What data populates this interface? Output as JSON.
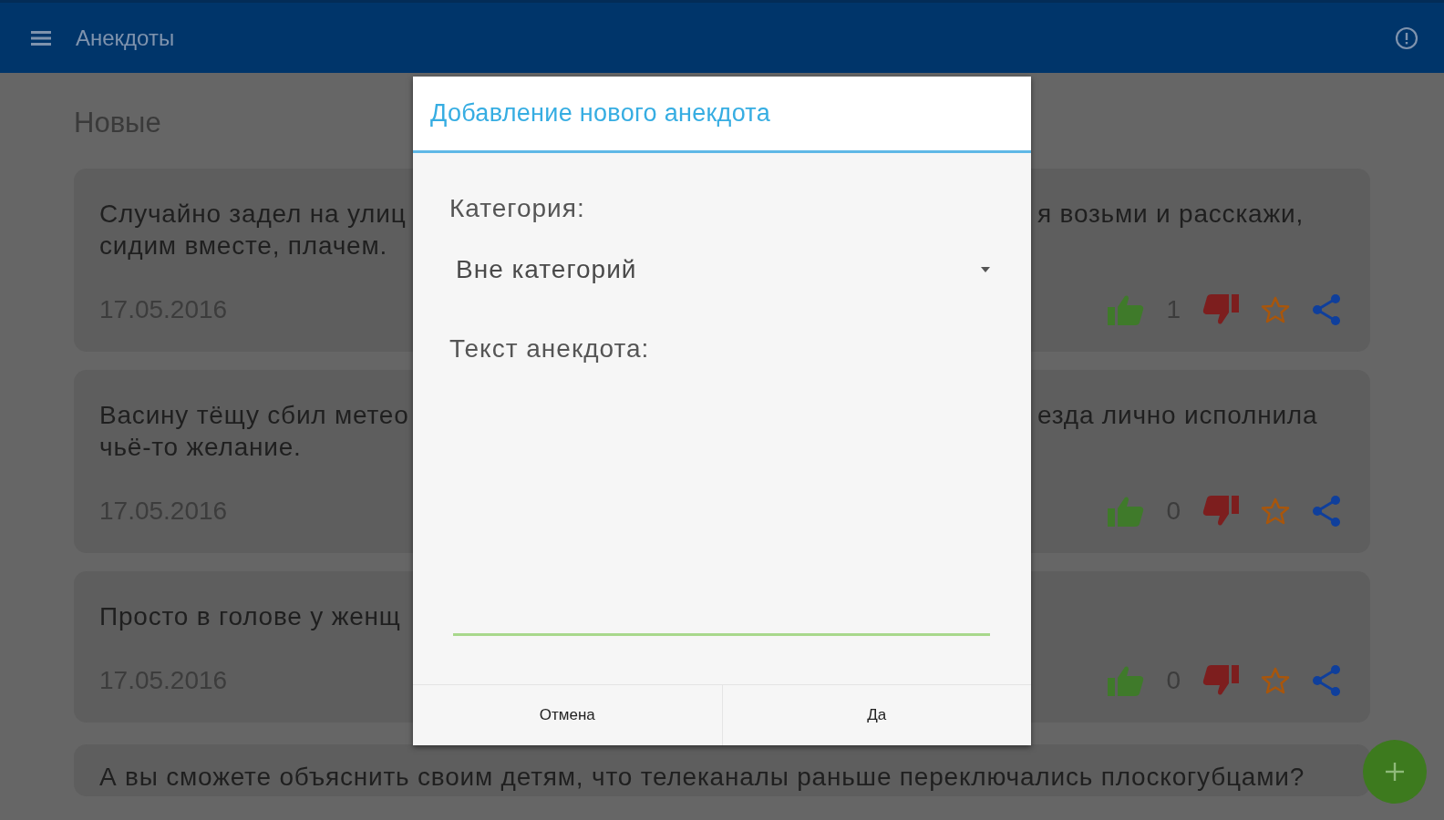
{
  "app_bar": {
    "title": "Анекдоты"
  },
  "section_title": "Новые",
  "jokes": [
    {
      "text_left": [
        "Случайно задел на улиц",
        "сидим вместе, плачем."
      ],
      "text_right": [
        "я возьми и расскажи,"
      ],
      "date": "17.05.2016",
      "likes": "1"
    },
    {
      "text_left": [
        "Васину тёщу сбил метео",
        "чьё-то желание."
      ],
      "text_right": [
        "езда лично исполнила"
      ],
      "date": "17.05.2016",
      "likes": "0"
    },
    {
      "text_left": [
        "Просто в голове у женщ"
      ],
      "date": "17.05.2016",
      "likes": "0"
    },
    {
      "text": "А вы сможете объяснить своим детям, что телеканалы раньше переключались плоскогубцами?"
    }
  ],
  "dialog": {
    "title": "Добавление нового анекдота",
    "category_label": "Категория:",
    "category_value": "Вне категорий",
    "text_label": "Текст анекдота:",
    "buttons": [
      "Отмена",
      "Да"
    ]
  }
}
